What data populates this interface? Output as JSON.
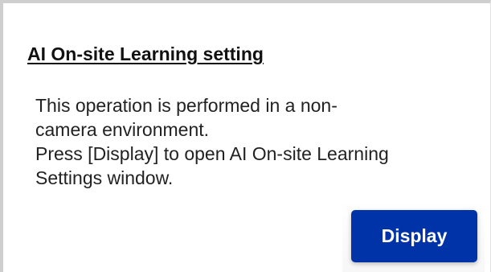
{
  "section": {
    "title": "AI On-site Learning setting",
    "message_lines": [
      "This operation is performed in a non-",
      "camera environment.",
      "Press [Display] to open AI On-site Learning",
      "Settings window."
    ],
    "display_button_label": "Display"
  },
  "colors": {
    "button_background": "#0033a8",
    "button_text": "#ffffff",
    "panel_border": "#cfcfcf"
  }
}
